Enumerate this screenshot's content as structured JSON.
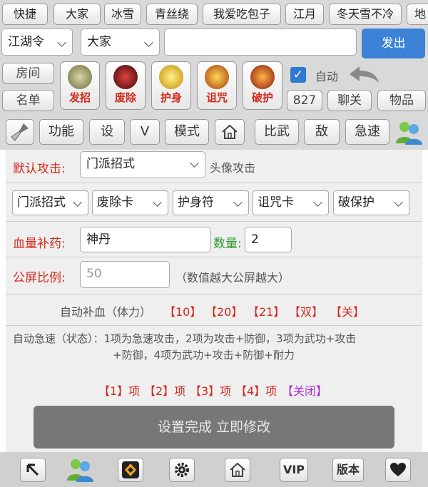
{
  "channel_tabs": [
    "快捷",
    "大家",
    "冰雪",
    "青丝绕",
    "我爱吃包子",
    "江月",
    "冬天雪不冷",
    "地"
  ],
  "chat": {
    "channel_select": "江湖令",
    "target_select": "大家",
    "message_placeholder": "",
    "send_label": "发出"
  },
  "side": {
    "room_label": "房间",
    "list_label": "名单"
  },
  "skills": [
    {
      "label": "发招",
      "color": "#6b6b3a"
    },
    {
      "label": "废除",
      "color": "#8a1515"
    },
    {
      "label": "护身",
      "color": "#e6b50c"
    },
    {
      "label": "诅咒",
      "color": "#c4520e"
    },
    {
      "label": "破护",
      "color": "#d44a10"
    }
  ],
  "auto": {
    "checked": true,
    "label": "自动"
  },
  "stats": {
    "count": "827",
    "chat_close": "聊关",
    "items": "物品"
  },
  "function_bar": {
    "func": "功能",
    "set": "设",
    "v": "V",
    "mode": "模式",
    "duel": "比武",
    "enemy": "敌",
    "haste": "急速"
  },
  "settings": {
    "default_attack_label": "默认攻击:",
    "default_attack_value": "门派招式",
    "avatar_attack": "头像攻击",
    "dropdowns": [
      "门派招式",
      "废除卡",
      "护身符",
      "诅咒卡",
      "破保护"
    ],
    "hp_potion_label": "血量补药:",
    "hp_potion_value": "神丹",
    "quantity_label": "数量:",
    "quantity_value": "2",
    "public_ratio_label": "公屏比例:",
    "public_ratio_placeholder": "50",
    "public_ratio_hint": "（数值越大公屏越大）",
    "auto_heal_label": "自动补血（体力）",
    "auto_heal_options": [
      "【10】",
      "【20】",
      "【21】",
      "【双】",
      "【关】"
    ],
    "auto_haste_line1": "自动急速（状态）：1项为急速攻击，2项为攻击+防御，3项为武功+攻击",
    "auto_haste_line2": "+防御，4项为武功+攻击+防御+耐力",
    "haste_options": [
      "【1】项",
      "【2】项",
      "【3】项",
      "【4】项"
    ],
    "haste_close": "【关闭】",
    "confirm_label": "设置完成 立即修改"
  },
  "bottom_bar": {
    "vip": "VIP",
    "version": "版本"
  }
}
